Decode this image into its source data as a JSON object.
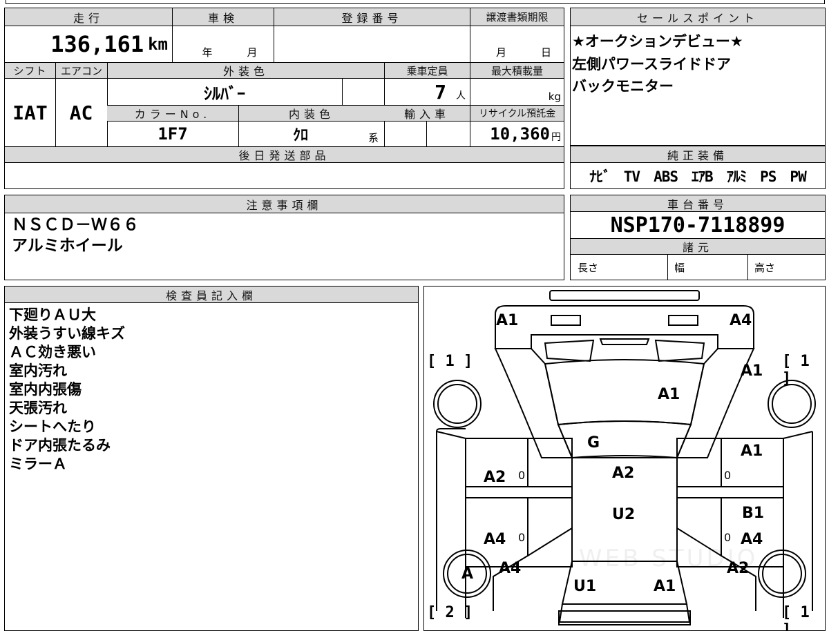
{
  "vehicle": {
    "mileage_label": "走行",
    "mileage": "136,161",
    "mileage_unit": "km",
    "inspection_label": "車検",
    "inspection_year": "年",
    "inspection_month": "月",
    "registration_label": "登録番号",
    "transfer_deadline_label": "譲渡書類期限",
    "transfer_month": "月",
    "transfer_day": "日",
    "shift_label": "シフト",
    "shift": "IAT",
    "ac_label": "エアコン",
    "ac": "AC",
    "exterior_color_label": "外装色",
    "exterior_color": "ｼﾙﾊﾞｰ",
    "capacity_label": "乗車定員",
    "capacity": "7",
    "capacity_unit": "人",
    "max_load_label": "最大積載量",
    "max_load_unit": "kg",
    "color_no_label": "カラーNo.",
    "color_no": "1F7",
    "interior_color_label": "内装色",
    "interior_color": "ｸﾛ",
    "interior_suffix": "系",
    "import_label": "輸入車",
    "recycle_label": "リサイクル預託金",
    "recycle_fee": "10,360",
    "recycle_unit": "円",
    "later_parts_label": "後日発送部品"
  },
  "sales": {
    "label": "セールスポイント",
    "lines": [
      "★オークションデビュー★",
      "左側パワースライドドア",
      "バックモニター"
    ]
  },
  "equipment": {
    "label": "純正装備",
    "items": "ﾅﾋﾞ　TV　ABS　ｴｱB　ｱﾙﾐ　PS　PW"
  },
  "notes": {
    "label": "注意事項欄",
    "lines": [
      "ＮＳＣＤ－Ｗ６６",
      "アルミホイール"
    ]
  },
  "chassis": {
    "label": "車台番号",
    "number": "NSP170-7118899",
    "specs_label": "諸元",
    "length_label": "長さ",
    "width_label": "幅",
    "height_label": "高さ"
  },
  "inspector": {
    "label": "検査員記入欄",
    "lines": [
      "下廻りＡＵ大",
      "外装うすい線キズ",
      "ＡＣ効き悪い",
      "室内汚れ",
      "室内内張傷",
      "天張汚れ",
      "シートへたり",
      "ドア内張たるみ",
      "ミラーＡ"
    ]
  },
  "diagram": {
    "marks": {
      "front_left": "A1",
      "front_right": "A4",
      "hood": "A1",
      "right_fender": "A1",
      "windshield": "G",
      "right_front_door": "A1",
      "left_front_door": "A2",
      "roof": "A2",
      "right_rear_door": "B1",
      "rear_roof": "U2",
      "left_rear_door": "A4",
      "right_slide": "A4",
      "left_quarter": "A4",
      "right_quarter": "A2",
      "rear_left": "U1",
      "rear_right": "A1",
      "left_rear_wheel": "A"
    },
    "brackets": {
      "left_top": "[ 1 ]",
      "right_top": "[ 1 ]",
      "left_bottom": "[ 2 ]",
      "right_bottom": "[ 1 ]"
    },
    "zero": "0",
    "watermark": "WEB STUDIO"
  },
  "colors": {
    "header_bg": "#d9d9d9",
    "border": "#000000"
  }
}
